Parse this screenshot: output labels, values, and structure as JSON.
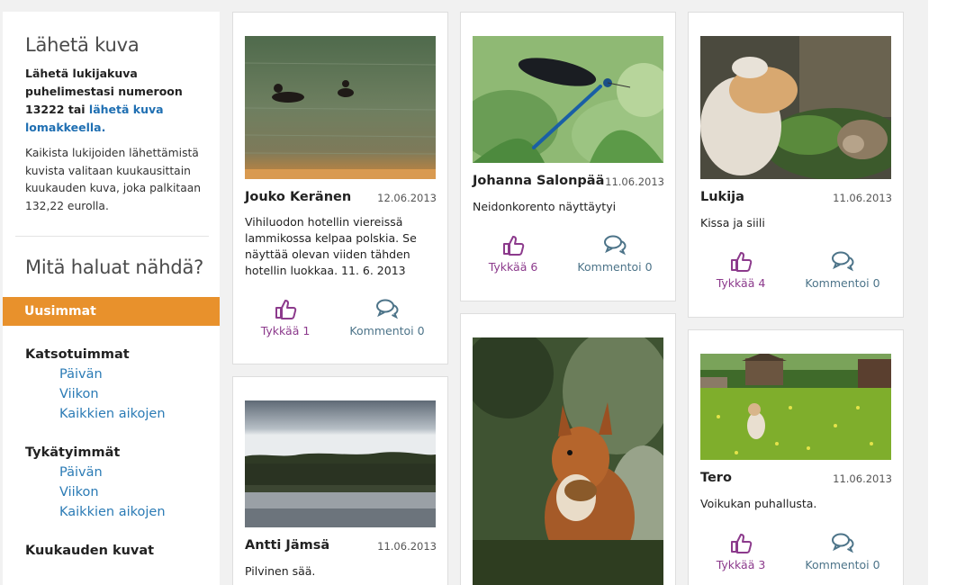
{
  "sidebar": {
    "send_title": "Lähetä kuva",
    "send_bold": "Lähetä lukijakuva puhelimestasi numeroon 13222 tai",
    "send_link": "lähetä kuva lomakkeella.",
    "prize_text": "Kaikista lukijoiden lähettämistä kuvista valitaan kuukausittain kuukauden kuva, joka palkitaan 132,22 eurolla.",
    "view_title": "Mitä haluat nähdä?",
    "newest": "Uusimmat",
    "most_viewed": "Katsotuimmat",
    "most_viewed_links": [
      "Päivän",
      "Viikon",
      "Kaikkien aikojen"
    ],
    "most_liked": "Tykätyimmät",
    "most_liked_links": [
      "Päivän",
      "Viikon",
      "Kaikkien aikojen"
    ],
    "month_photos": "Kuukauden kuvat"
  },
  "cards": [
    {
      "author": "Jouko Keränen",
      "date": "12.06.2013",
      "desc": "Vihiluodon hotellin viereissä lammikossa kelpaa polskia. Se näyttää olevan viiden tähden hotellin luokkaa. 11. 6. 2013",
      "likes": "Tykkää 1",
      "comments": "Kommentoi 0",
      "photo": "ducks"
    },
    {
      "author": "Johanna Salonpää",
      "date": "11.06.2013",
      "desc": "Neidonkorento näyttäytyi",
      "likes": "Tykkää 6",
      "comments": "Kommentoi 0",
      "photo": "dragonfly"
    },
    {
      "author": "Lukija",
      "date": "11.06.2013",
      "desc": "Kissa ja siili",
      "likes": "Tykkää 4",
      "comments": "Kommentoi 0",
      "photo": "cat-hedgehog"
    },
    {
      "author": "Antti Jämsä",
      "date": "11.06.2013",
      "desc": "Pilvinen sää.",
      "photo": "lake"
    },
    {
      "photo": "squirrel"
    },
    {
      "author": "Tero",
      "date": "11.06.2013",
      "desc": "Voikukan puhallusta.",
      "likes": "Tykkää 3",
      "comments": "Kommentoi 0",
      "photo": "meadow"
    }
  ],
  "colors": {
    "accent": "#e8912c",
    "link": "#2b7bb5",
    "like": "#8c3a8c",
    "comment": "#4d7489"
  },
  "icons": {
    "like": "thumbs-up-icon",
    "comment": "comment-bubbles-icon"
  }
}
